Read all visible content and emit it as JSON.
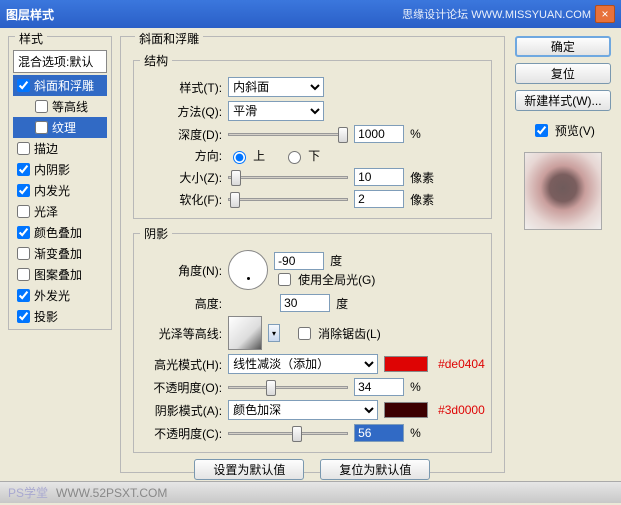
{
  "window": {
    "title": "图层样式",
    "brand": "思缘设计论坛  WWW.MISSYUAN.COM",
    "close": "×"
  },
  "left": {
    "legend": "样式",
    "blend_header": "混合选项:默认",
    "items": [
      {
        "label": "斜面和浮雕",
        "checked": true,
        "sel": true,
        "sub": false
      },
      {
        "label": "等高线",
        "checked": false,
        "sel": false,
        "sub": true
      },
      {
        "label": "纹理",
        "checked": false,
        "sel": true,
        "sub": true
      },
      {
        "label": "描边",
        "checked": false,
        "sel": false,
        "sub": false
      },
      {
        "label": "内阴影",
        "checked": true,
        "sel": false,
        "sub": false
      },
      {
        "label": "内发光",
        "checked": true,
        "sel": false,
        "sub": false
      },
      {
        "label": "光泽",
        "checked": false,
        "sel": false,
        "sub": false
      },
      {
        "label": "颜色叠加",
        "checked": true,
        "sel": false,
        "sub": false
      },
      {
        "label": "渐变叠加",
        "checked": false,
        "sel": false,
        "sub": false
      },
      {
        "label": "图案叠加",
        "checked": false,
        "sel": false,
        "sub": false
      },
      {
        "label": "外发光",
        "checked": true,
        "sel": false,
        "sub": false
      },
      {
        "label": "投影",
        "checked": true,
        "sel": false,
        "sub": false
      }
    ]
  },
  "mid": {
    "panel_legend": "斜面和浮雕",
    "struct_legend": "结构",
    "style_lbl": "样式(T):",
    "style_val": "内斜面",
    "method_lbl": "方法(Q):",
    "method_val": "平滑",
    "depth_lbl": "深度(D):",
    "depth_val": "1000",
    "pct": "%",
    "dir_lbl": "方向:",
    "up": "上",
    "down": "下",
    "size_lbl": "大小(Z):",
    "size_val": "10",
    "px": "像素",
    "soften_lbl": "软化(F):",
    "soften_val": "2",
    "shadow_legend": "阴影",
    "angle_lbl": "角度(N):",
    "angle_val": "-90",
    "deg": "度",
    "global_lbl": "使用全局光(G)",
    "alt_lbl": "高度:",
    "alt_val": "30",
    "gloss_lbl": "光泽等高线:",
    "aa_lbl": "消除锯齿(L)",
    "hl_mode_lbl": "高光模式(H):",
    "hl_mode_val": "线性减淡（添加）",
    "hl_color_hex": "#de0404",
    "opacity_lbl": "不透明度(O):",
    "hl_op_val": "34",
    "sh_mode_lbl": "阴影模式(A):",
    "sh_mode_val": "颜色加深",
    "sh_color_hex": "#3d0000",
    "opacity2_lbl": "不透明度(C):",
    "sh_op_val": "56",
    "make_default": "设置为默认值",
    "reset_default": "复位为默认值"
  },
  "right": {
    "ok": "确定",
    "cancel": "复位",
    "new_style": "新建样式(W)...",
    "preview_lbl": "预览(V)"
  },
  "footer": {
    "left_badge": "PS学堂",
    "left_url": "WWW.52PSXT.COM"
  }
}
